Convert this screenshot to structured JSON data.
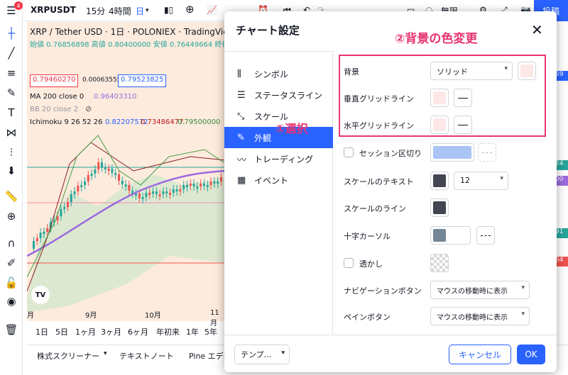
{
  "app": {
    "symbol": "XRPUSDT",
    "interval": "15分",
    "interval_alt": "4時間",
    "interval_day": "日",
    "post_button": "投稿",
    "reset_label": "無限",
    "badge_count": "4"
  },
  "chart": {
    "legend_title": "XRP / Tether USD · 1日 · POLONIEX · TradingView",
    "ohlc": "始値 0.76856898 高値 0.80400000 安値 0.76449664 終値 0.79",
    "price_sell": "0.79460270",
    "spread": "0.00063555",
    "price_buy": "0.79523825",
    "ma": "MA 200 close 0",
    "ma_value": "0.96403310",
    "bb": "BB 20 close 2",
    "ichimoku": "Ichimoku 9 26 52 26",
    "ichimoku_v1": "0.82207572",
    "ichimoku_v2": "0.73486477",
    "ichimoku_v3": "0.79500000",
    "logo": "TV",
    "dates": [
      "月",
      "9月",
      "10月",
      "11月"
    ],
    "ranges": [
      "1日",
      "5日",
      "1ヶ月",
      "3ヶ月",
      "6ヶ月",
      "年初来",
      "1年",
      "5年"
    ],
    "right_labels": [
      "59",
      "24",
      "00",
      "91",
      "64"
    ],
    "colors": {
      "up": "#26a69a",
      "down": "#ef5350",
      "ma": "#9c6ade",
      "cloud": "#c8e6c9"
    }
  },
  "bottom": {
    "screener": "株式スクリーナー",
    "textnote": "テキストノート",
    "pine": "Pine エディ"
  },
  "dialog": {
    "title": "チャート設定",
    "nav": [
      {
        "label": "シンボル",
        "icon": "candle-icon"
      },
      {
        "label": "ステータスライン",
        "icon": "status-line-icon"
      },
      {
        "label": "スケール",
        "icon": "scale-icon"
      },
      {
        "label": "外観",
        "icon": "pencil-icon"
      },
      {
        "label": "トレーディング",
        "icon": "trading-icon"
      },
      {
        "label": "イベント",
        "icon": "calendar-icon"
      }
    ],
    "rows": {
      "background": "背景",
      "background_value": "ソリッド",
      "vgrid": "垂直グリッドライン",
      "hgrid": "水平グリッドライン",
      "session": "セッション区切り",
      "scale_text": "スケールのテキスト",
      "scale_text_size": "12",
      "scale_line": "スケールのライン",
      "crosshair": "十字カーソル",
      "watermark": "透かし",
      "nav_buttons": "ナビゲーションボタン",
      "nav_buttons_value": "マウスの移動時に表示",
      "pane_buttons": "ペインボタン",
      "pane_buttons_value": "マウスの移動時に表示"
    },
    "colors": {
      "background": "#fde7e7",
      "vgrid": "#fde7e7",
      "hgrid": "#fde7e7",
      "session": "#a9c4f5",
      "scale_text": "#434651",
      "scale_line": "#434651",
      "crosshair": "#758696"
    },
    "footer": {
      "template": "テンプ...",
      "cancel": "キャンセル",
      "ok": "OK"
    }
  },
  "annotations": {
    "step1": "①選択",
    "step2": "②背景の色変更"
  }
}
